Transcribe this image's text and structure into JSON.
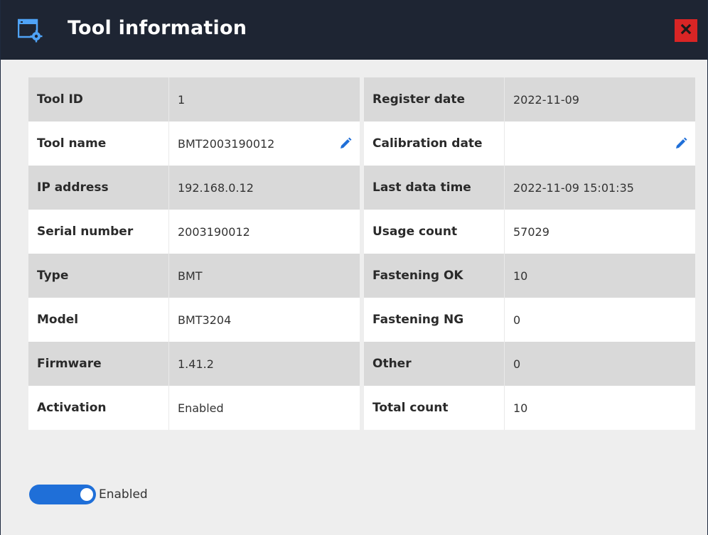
{
  "window": {
    "title": "Tool information",
    "icon": "window-settings-icon",
    "close_icon": "close-icon"
  },
  "colors": {
    "titlebar_bg": "#1e2533",
    "close_bg": "#d92525",
    "accent": "#1f6fd8",
    "row_shaded": "#d9d9d9",
    "row_plain": "#ffffff"
  },
  "left_table": [
    {
      "label": "Tool ID",
      "value": "1"
    },
    {
      "label": "Tool name",
      "value": "BMT2003190012",
      "editable": true
    },
    {
      "label": "IP address",
      "value": "192.168.0.12"
    },
    {
      "label": "Serial number",
      "value": "2003190012"
    },
    {
      "label": "Type",
      "value": "BMT"
    },
    {
      "label": "Model",
      "value": "BMT3204"
    },
    {
      "label": "Firmware",
      "value": "1.41.2"
    },
    {
      "label": "Activation",
      "value": "Enabled"
    }
  ],
  "right_table": [
    {
      "label": "Register date",
      "value": "2022-11-09"
    },
    {
      "label": "Calibration date",
      "value": "",
      "editable": true
    },
    {
      "label": "Last data time",
      "value": "2022-11-09 15:01:35"
    },
    {
      "label": "Usage count",
      "value": "57029"
    },
    {
      "label": "Fastening OK",
      "value": "10"
    },
    {
      "label": "Fastening NG",
      "value": "0"
    },
    {
      "label": "Other",
      "value": "0"
    },
    {
      "label": "Total count",
      "value": "10"
    }
  ],
  "activation_toggle": {
    "label": "Enabled",
    "on": true
  }
}
